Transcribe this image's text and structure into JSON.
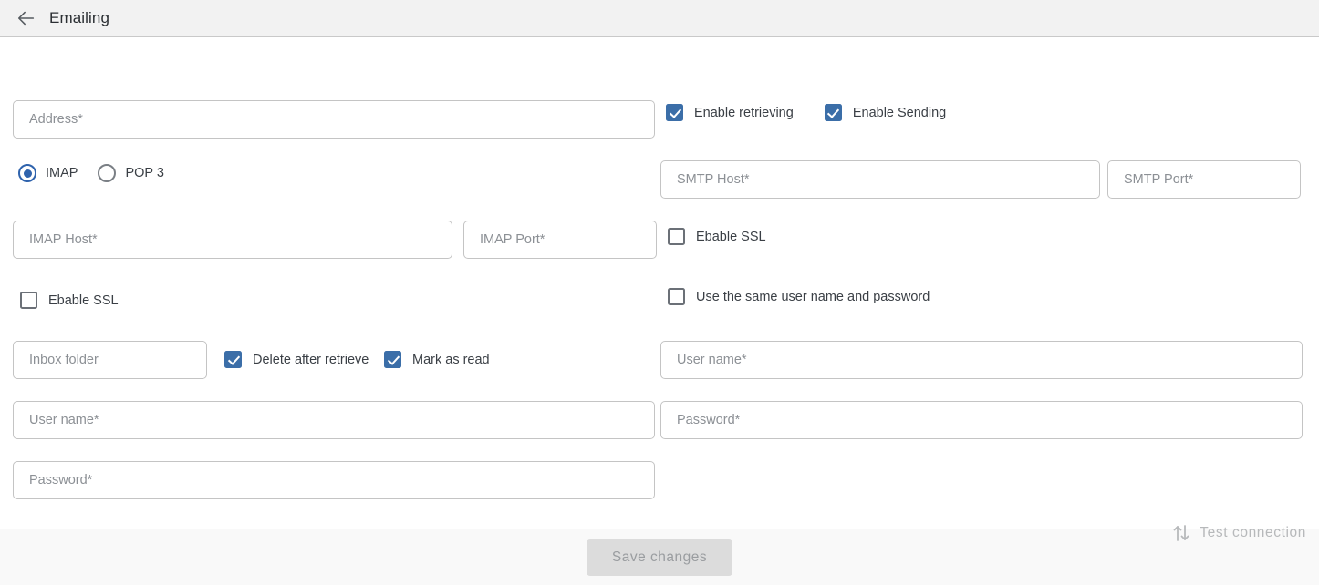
{
  "header": {
    "title": "Emailing",
    "back_icon": "arrow-left-icon"
  },
  "left_panel": {
    "address": {
      "placeholder": "Address*",
      "value": ""
    },
    "protocol": {
      "options": [
        {
          "label": "IMAP",
          "selected": true
        },
        {
          "label": "POP 3",
          "selected": false
        }
      ]
    },
    "imap_host": {
      "placeholder": "IMAP Host*",
      "value": ""
    },
    "imap_port": {
      "placeholder": "IMAP Port*",
      "value": ""
    },
    "enable_ssl": {
      "label": "Ebable SSL",
      "checked": false
    },
    "inbox_folder": {
      "placeholder": "Inbox folder",
      "value": ""
    },
    "delete_after_retrieve": {
      "label": "Delete after retrieve",
      "checked": true
    },
    "mark_as_read": {
      "label": "Mark as read",
      "checked": true
    },
    "user_name": {
      "placeholder": "User name*",
      "value": ""
    },
    "password": {
      "placeholder": "Password*",
      "value": ""
    }
  },
  "right_panel": {
    "enable_retrieving": {
      "label": "Enable retrieving",
      "checked": true
    },
    "enable_sending": {
      "label": "Enable Sending",
      "checked": true
    },
    "smtp_host": {
      "placeholder": "SMTP Host*",
      "value": ""
    },
    "smtp_port": {
      "placeholder": "SMTP Port*",
      "value": ""
    },
    "enable_ssl": {
      "label": "Ebable SSL",
      "checked": false
    },
    "use_same_credentials": {
      "label": "Use the same user name and password",
      "checked": false
    },
    "user_name": {
      "placeholder": "User name*",
      "value": ""
    },
    "password": {
      "placeholder": "Password*",
      "value": ""
    }
  },
  "test_connection": {
    "label": "Test connection",
    "icon": "transfer-arrows-icon",
    "enabled": false
  },
  "footer": {
    "save_label": "Save changes",
    "save_enabled": false
  },
  "colors": {
    "accent": "#3b6ea8",
    "radio_accent": "#2f63ad",
    "header_bg": "#f2f2f2",
    "footer_bg": "#f9f9f9",
    "border": "#c4c4c4",
    "placeholder": "#8c9095",
    "disabled_text": "#b7b9bb"
  }
}
